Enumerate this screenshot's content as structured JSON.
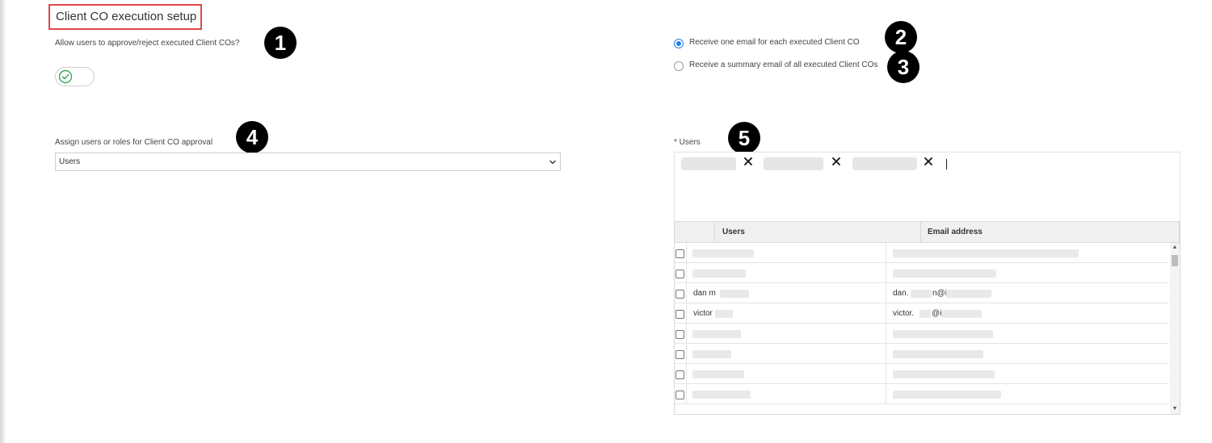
{
  "section": {
    "title": "Client CO execution setup"
  },
  "approve": {
    "question": "Allow users to approve/reject executed Client COs?",
    "toggle_on": true
  },
  "email_options": [
    {
      "label": "Receive one email for each executed Client CO",
      "selected": true
    },
    {
      "label": "Receive a summary email of all executed Client COs",
      "selected": false
    }
  ],
  "assign": {
    "label": "Assign users or roles for Client CO approval",
    "selected_value": "Users"
  },
  "users_field": {
    "label": "* Users"
  },
  "callouts": [
    "1",
    "2",
    "3",
    "4",
    "5"
  ],
  "grid": {
    "columns": [
      "Users",
      "Email address"
    ],
    "rows": [
      {
        "user": "",
        "email": ""
      },
      {
        "user": "",
        "email": ""
      },
      {
        "user": "dan m",
        "email": "dan.",
        "email_suffix": "n@i"
      },
      {
        "user": "victor",
        "email": "victor.",
        "email_suffix": "@i"
      },
      {
        "user": "",
        "email": ""
      },
      {
        "user": "",
        "email": ""
      },
      {
        "user": "",
        "email": ""
      },
      {
        "user": "",
        "email": ""
      }
    ]
  },
  "colors": {
    "accent_blue": "#2a7de1",
    "highlight_red": "#e0474c",
    "check_green": "#3aa55d"
  },
  "icons": {
    "toggle": "check-circle-icon",
    "remove_chip": "close-icon",
    "dropdown": "chevron-down-icon"
  }
}
